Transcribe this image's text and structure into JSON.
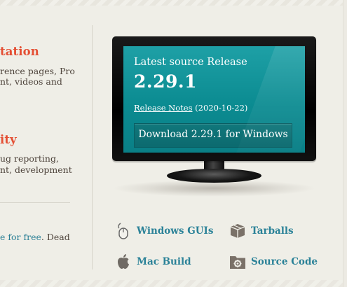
{
  "left_column": {
    "section1": {
      "title": "tation",
      "lines": [
        "rence pages, Pro",
        "nt, videos and"
      ]
    },
    "section2": {
      "title": "ity",
      "lines": [
        "ug reporting,",
        "nt, development"
      ]
    },
    "section3": {
      "link_text": "e for free",
      "text_after": ". Dead"
    }
  },
  "release_box": {
    "label": "Latest source Release",
    "version": "2.29.1",
    "notes_link": "Release Notes",
    "notes_date": "(2020-10-22)",
    "download_button": "Download 2.29.1 for Windows"
  },
  "download_links": [
    {
      "label": "Windows GUIs",
      "icon": "mouse-icon"
    },
    {
      "label": "Tarballs",
      "icon": "box-icon"
    },
    {
      "label": "Mac Build",
      "icon": "apple-icon"
    },
    {
      "label": "Source Code",
      "icon": "folder-gear-icon"
    }
  ],
  "colors": {
    "accent_red": "#e44f34",
    "link_teal": "#2b8298",
    "screen_teal": "#0e8e94",
    "background": "#efeee7"
  }
}
